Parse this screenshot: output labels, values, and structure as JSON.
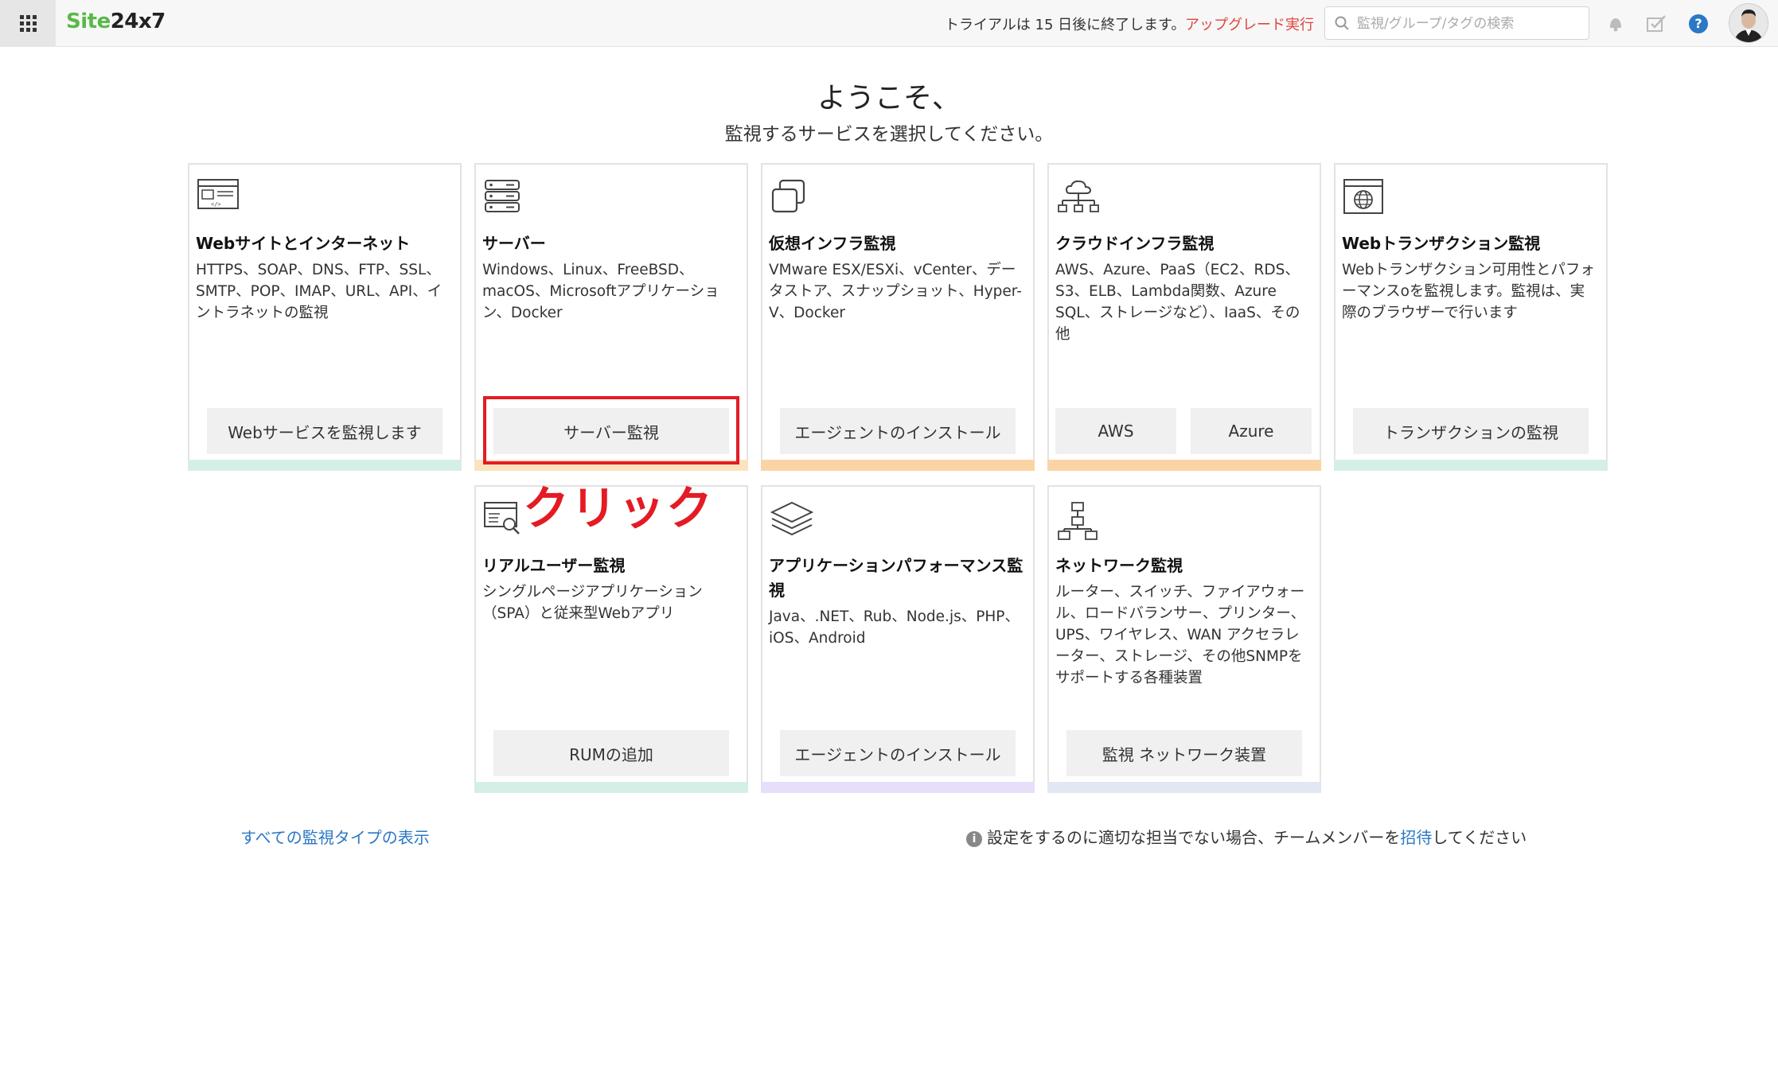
{
  "topbar": {
    "logo_site": "Site",
    "logo_num": "24x7",
    "trial_text": "トライアルは 15 日後に終了します。",
    "upgrade_label": "アップグレード実行",
    "search_placeholder": "監視/グループ/タグの検索",
    "help_label": "?"
  },
  "heading": {
    "welcome": "ようこそ、",
    "subtitle": "監視するサービスを選択してください。"
  },
  "cards": [
    {
      "title": "Webサイトとインターネット",
      "desc": "HTTPS、SOAP、DNS、FTP、SSL、SMTP、POP、IMAP、URL、API、イントラネットの監視",
      "button": "Webサービスを監視します",
      "accent": "#d6efe6"
    },
    {
      "title": "サーバー",
      "desc": "Windows、Linux、FreeBSD、macOS、Microsoftアプリケーション、Docker",
      "button": "サーバー監視",
      "accent": "#fbe3c0"
    },
    {
      "title": "仮想インフラ監視",
      "desc": "VMware ESX/ESXi、vCenter、データストア、スナップショット、Hyper-V、Docker",
      "button": "エージェントのインストール",
      "accent": "#fbd4a6"
    },
    {
      "title": "クラウドインフラ監視",
      "desc": "AWS、Azure、PaaS（EC2、RDS、S3、ELB、Lambda関数、Azure SQL、ストレージなど）、IaaS、その他",
      "button": "AWS",
      "button2": "Azure",
      "accent": "#fbd4a6"
    },
    {
      "title": "Webトランザクション監視",
      "desc": "Webトランザクション可用性とパフォーマンスoを監視します。監視は、実際のブラウザーで行います",
      "button": "トランザクションの監視",
      "accent": "#d6efe6"
    },
    {
      "title": "リアルユーザー監視",
      "desc": "シングルページアプリケーション（SPA）と従来型Webアプリ",
      "button": "RUMの追加",
      "accent": "#d6efe6"
    },
    {
      "title": "アプリケーションパフォーマンス監視",
      "desc": "Java、.NET、Rub、Node.js、PHP、iOS、Android",
      "button": "エージェントのインストール",
      "accent": "#e7defa"
    },
    {
      "title": "ネットワーク監視",
      "desc": "ルーター、スイッチ、ファイアウォール、ロードバランサー、プリンター、UPS、ワイヤレス、WAN アクセラレーター、ストレージ、その他SNMPをサポートする各種装置",
      "button": "監視 ネットワーク装置",
      "accent": "#e3e7f3"
    }
  ],
  "annotation": {
    "click_label": "クリック",
    "color": "#e41b23"
  },
  "footer": {
    "all_types_link": "すべての監視タイプの表示",
    "note_info": "i",
    "note_before": "設定をするのに適切な担当でない場合、チームメンバーを",
    "note_invite": "招待",
    "note_after": "してください"
  },
  "colors": {
    "brand_green": "#58b947",
    "link_blue": "#2b78c6",
    "upgrade_red": "#e0453d"
  }
}
